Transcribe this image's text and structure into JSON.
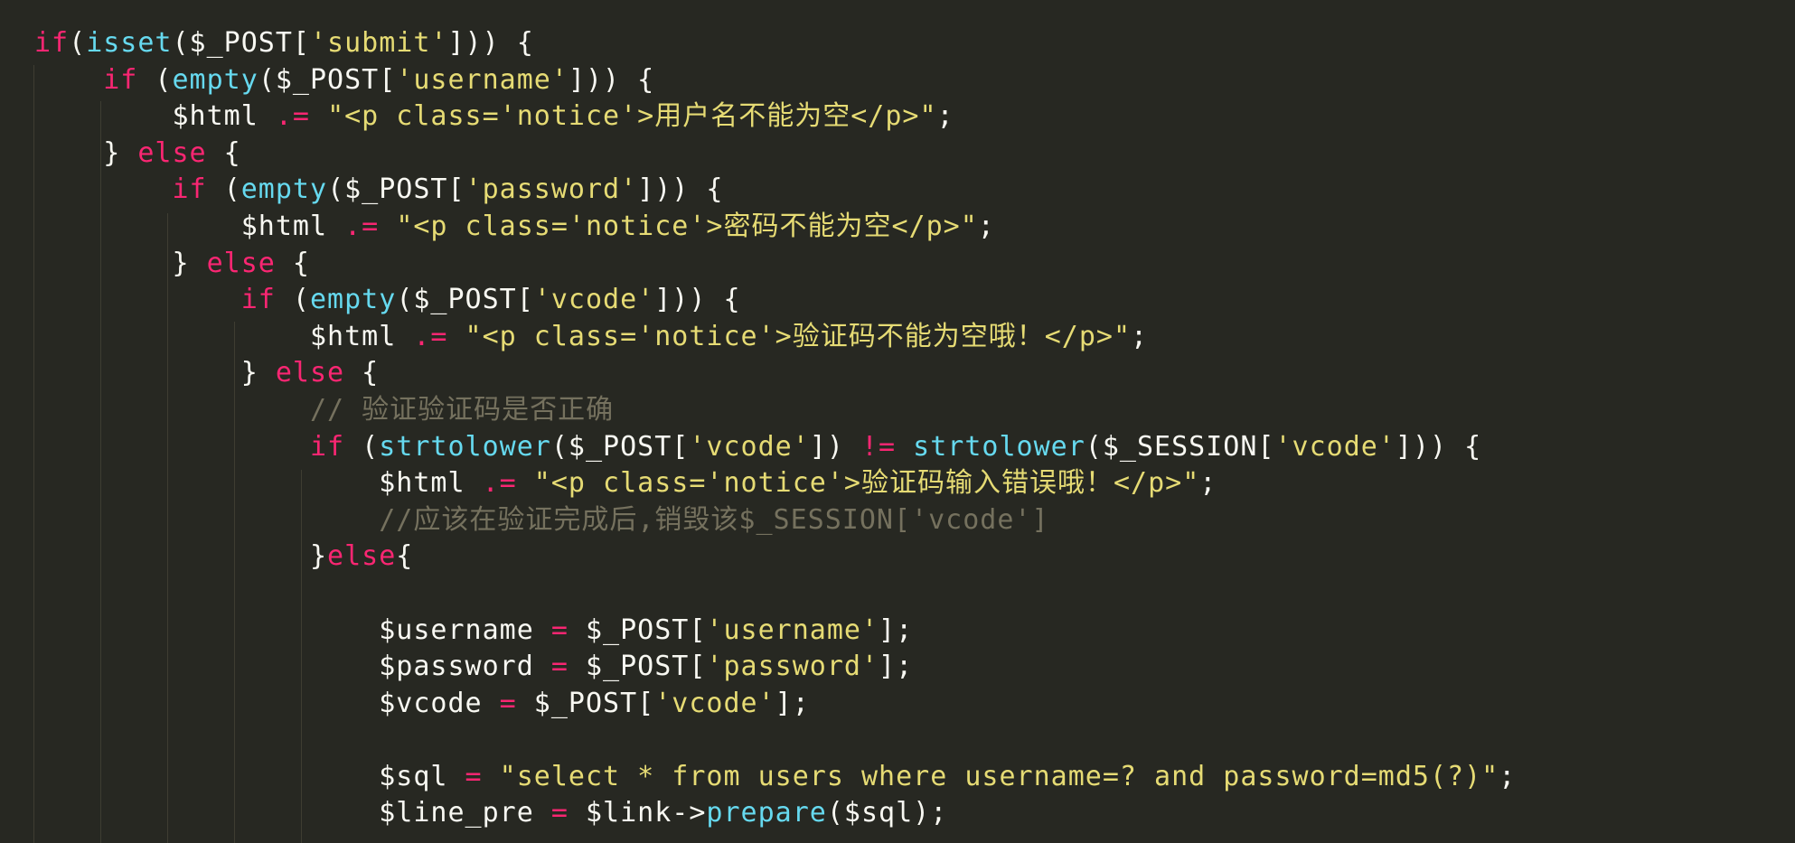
{
  "editor": {
    "theme": "monokai",
    "colors": {
      "background": "#272822",
      "keyword": "#f92672",
      "function": "#66d9ef",
      "string": "#e6db74",
      "plain": "#f8f8f2",
      "comment": "#75715e",
      "indent_guide": "#3e3d32"
    },
    "lines": [
      {
        "indent": 0,
        "tokens": [
          {
            "t": "kw",
            "v": "if"
          },
          {
            "t": "pl",
            "v": "("
          },
          {
            "t": "fn",
            "v": "isset"
          },
          {
            "t": "pl",
            "v": "($_POST["
          },
          {
            "t": "str",
            "v": "'submit'"
          },
          {
            "t": "pl",
            "v": "])) {"
          }
        ]
      },
      {
        "indent": 1,
        "tokens": [
          {
            "t": "kw",
            "v": "if"
          },
          {
            "t": "pl",
            "v": " ("
          },
          {
            "t": "fn",
            "v": "empty"
          },
          {
            "t": "pl",
            "v": "($_POST["
          },
          {
            "t": "str",
            "v": "'username'"
          },
          {
            "t": "pl",
            "v": "])) {"
          }
        ]
      },
      {
        "indent": 2,
        "tokens": [
          {
            "t": "pl",
            "v": "$html "
          },
          {
            "t": "op",
            "v": ".="
          },
          {
            "t": "pl",
            "v": " "
          },
          {
            "t": "str",
            "v": "\"<p class='notice'>用户名不能为空</p>\""
          },
          {
            "t": "pl",
            "v": ";"
          }
        ]
      },
      {
        "indent": 1,
        "tokens": [
          {
            "t": "pl",
            "v": "} "
          },
          {
            "t": "kw",
            "v": "else"
          },
          {
            "t": "pl",
            "v": " {"
          }
        ]
      },
      {
        "indent": 2,
        "tokens": [
          {
            "t": "kw",
            "v": "if"
          },
          {
            "t": "pl",
            "v": " ("
          },
          {
            "t": "fn",
            "v": "empty"
          },
          {
            "t": "pl",
            "v": "($_POST["
          },
          {
            "t": "str",
            "v": "'password'"
          },
          {
            "t": "pl",
            "v": "])) {"
          }
        ]
      },
      {
        "indent": 3,
        "tokens": [
          {
            "t": "pl",
            "v": "$html "
          },
          {
            "t": "op",
            "v": ".="
          },
          {
            "t": "pl",
            "v": " "
          },
          {
            "t": "str",
            "v": "\"<p class='notice'>密码不能为空</p>\""
          },
          {
            "t": "pl",
            "v": ";"
          }
        ]
      },
      {
        "indent": 2,
        "tokens": [
          {
            "t": "pl",
            "v": "} "
          },
          {
            "t": "kw",
            "v": "else"
          },
          {
            "t": "pl",
            "v": " {"
          }
        ]
      },
      {
        "indent": 3,
        "tokens": [
          {
            "t": "kw",
            "v": "if"
          },
          {
            "t": "pl",
            "v": " ("
          },
          {
            "t": "fn",
            "v": "empty"
          },
          {
            "t": "pl",
            "v": "($_POST["
          },
          {
            "t": "str",
            "v": "'vcode'"
          },
          {
            "t": "pl",
            "v": "])) {"
          }
        ]
      },
      {
        "indent": 4,
        "tokens": [
          {
            "t": "pl",
            "v": "$html "
          },
          {
            "t": "op",
            "v": ".="
          },
          {
            "t": "pl",
            "v": " "
          },
          {
            "t": "str",
            "v": "\"<p class='notice'>验证码不能为空哦！</p>\""
          },
          {
            "t": "pl",
            "v": ";"
          }
        ]
      },
      {
        "indent": 3,
        "tokens": [
          {
            "t": "pl",
            "v": "} "
          },
          {
            "t": "kw",
            "v": "else"
          },
          {
            "t": "pl",
            "v": " {"
          }
        ]
      },
      {
        "indent": 4,
        "tokens": [
          {
            "t": "cm",
            "v": "// 验证验证码是否正确"
          }
        ]
      },
      {
        "indent": 4,
        "tokens": [
          {
            "t": "kw",
            "v": "if"
          },
          {
            "t": "pl",
            "v": " ("
          },
          {
            "t": "fn",
            "v": "strtolower"
          },
          {
            "t": "pl",
            "v": "($_POST["
          },
          {
            "t": "str",
            "v": "'vcode'"
          },
          {
            "t": "pl",
            "v": "]) "
          },
          {
            "t": "op",
            "v": "!="
          },
          {
            "t": "pl",
            "v": " "
          },
          {
            "t": "fn",
            "v": "strtolower"
          },
          {
            "t": "pl",
            "v": "($_SESSION["
          },
          {
            "t": "str",
            "v": "'vcode'"
          },
          {
            "t": "pl",
            "v": "])) {"
          }
        ]
      },
      {
        "indent": 5,
        "tokens": [
          {
            "t": "pl",
            "v": "$html "
          },
          {
            "t": "op",
            "v": ".="
          },
          {
            "t": "pl",
            "v": " "
          },
          {
            "t": "str",
            "v": "\"<p class='notice'>验证码输入错误哦！</p>\""
          },
          {
            "t": "pl",
            "v": ";"
          }
        ]
      },
      {
        "indent": 5,
        "tokens": [
          {
            "t": "cm",
            "v": "//应该在验证完成后,销毁该$_SESSION['vcode']"
          }
        ]
      },
      {
        "indent": 4,
        "tokens": [
          {
            "t": "pl",
            "v": "}"
          },
          {
            "t": "kw",
            "v": "else"
          },
          {
            "t": "pl",
            "v": "{"
          }
        ]
      },
      {
        "indent": 0,
        "tokens": []
      },
      {
        "indent": 5,
        "tokens": [
          {
            "t": "pl",
            "v": "$username "
          },
          {
            "t": "op",
            "v": "="
          },
          {
            "t": "pl",
            "v": " $_POST["
          },
          {
            "t": "str",
            "v": "'username'"
          },
          {
            "t": "pl",
            "v": "];"
          }
        ]
      },
      {
        "indent": 5,
        "tokens": [
          {
            "t": "pl",
            "v": "$password "
          },
          {
            "t": "op",
            "v": "="
          },
          {
            "t": "pl",
            "v": " $_POST["
          },
          {
            "t": "str",
            "v": "'password'"
          },
          {
            "t": "pl",
            "v": "];"
          }
        ]
      },
      {
        "indent": 5,
        "tokens": [
          {
            "t": "pl",
            "v": "$vcode "
          },
          {
            "t": "op",
            "v": "="
          },
          {
            "t": "pl",
            "v": " $_POST["
          },
          {
            "t": "str",
            "v": "'vcode'"
          },
          {
            "t": "pl",
            "v": "];"
          }
        ]
      },
      {
        "indent": 0,
        "tokens": []
      },
      {
        "indent": 5,
        "tokens": [
          {
            "t": "pl",
            "v": "$sql "
          },
          {
            "t": "op",
            "v": "="
          },
          {
            "t": "pl",
            "v": " "
          },
          {
            "t": "str",
            "v": "\"select * from users where username=? and password=md5(?)\""
          },
          {
            "t": "pl",
            "v": ";"
          }
        ]
      },
      {
        "indent": 5,
        "tokens": [
          {
            "t": "pl",
            "v": "$line_pre "
          },
          {
            "t": "op",
            "v": "="
          },
          {
            "t": "pl",
            "v": " $link->"
          },
          {
            "t": "fn",
            "v": "prepare"
          },
          {
            "t": "pl",
            "v": "($sql);"
          }
        ]
      }
    ]
  }
}
